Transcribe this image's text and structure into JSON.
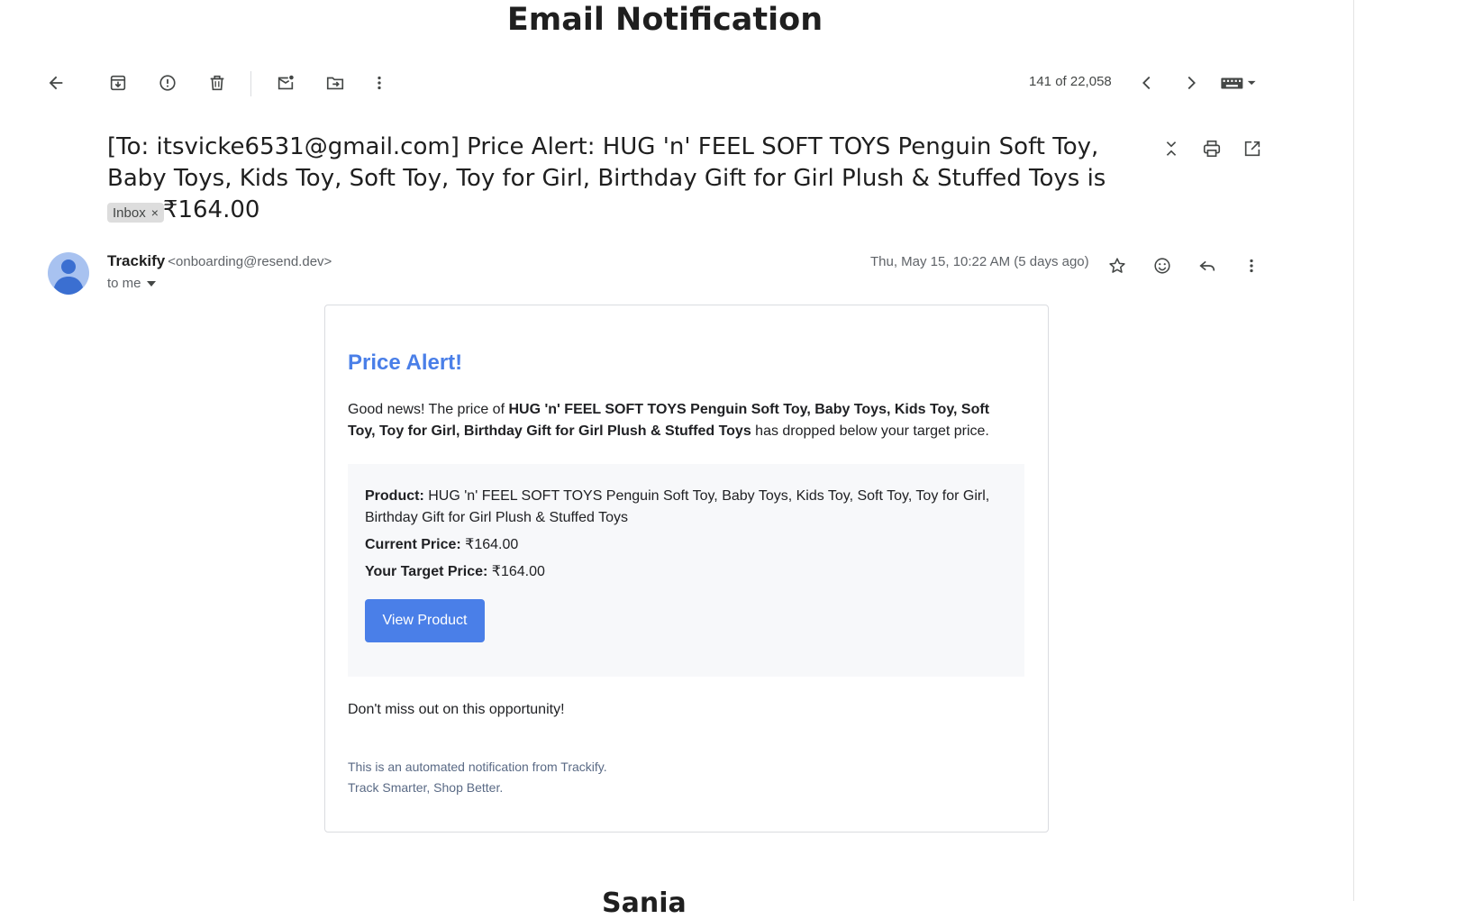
{
  "page": {
    "title": "Email Notification",
    "bottom_cut_text": "Sania"
  },
  "toolbar": {
    "icons": [
      "back-arrow-icon",
      "archive-icon",
      "report-spam-icon",
      "delete-icon",
      "mark-unread-icon",
      "move-to-icon",
      "more-vert-icon"
    ],
    "pager": "141 of 22,058"
  },
  "email": {
    "subject": "[To: itsvicke6531@gmail.com] Price Alert: HUG 'n' FEEL SOFT TOYS Penguin Soft Toy, Baby Toys, Kids Toy, Soft Toy, Toy for Girl, Birthday Gift for Girl Plush & Stuffed Toys is now ₹164.00",
    "label": "Inbox",
    "label_remove": "×",
    "sender_name": "Trackify",
    "sender_email": "<onboarding@resend.dev>",
    "recipients": "to me",
    "date": "Thu, May 15, 10:22 AM (5 days ago)"
  },
  "body": {
    "title": "Price Alert!",
    "intro_prefix": "Good news! The price of ",
    "product_name": "HUG 'n' FEEL SOFT TOYS Penguin Soft Toy, Baby Toys, Kids Toy, Soft Toy, Toy for Girl, Birthday Gift for Girl Plush & Stuffed Toys",
    "intro_suffix": " has dropped below your target price.",
    "product_label": "Product:",
    "product_value": "HUG 'n' FEEL SOFT TOYS Penguin Soft Toy, Baby Toys, Kids Toy, Soft Toy, Toy for Girl, Birthday Gift for Girl Plush & Stuffed Toys",
    "current_label": "Current Price:",
    "current_value": "₹164.00",
    "target_label": "Your Target Price:",
    "target_value": "₹164.00",
    "button": "View Product",
    "missout": "Don't miss out on this opportunity!",
    "footer_line1": "This is an automated notification from Trackify.",
    "footer_line2": "Track Smarter, Shop Better."
  },
  "colors": {
    "accent": "#4a7fe8",
    "footer_text": "#5a6a85",
    "info_bg": "#f7f8fa"
  }
}
